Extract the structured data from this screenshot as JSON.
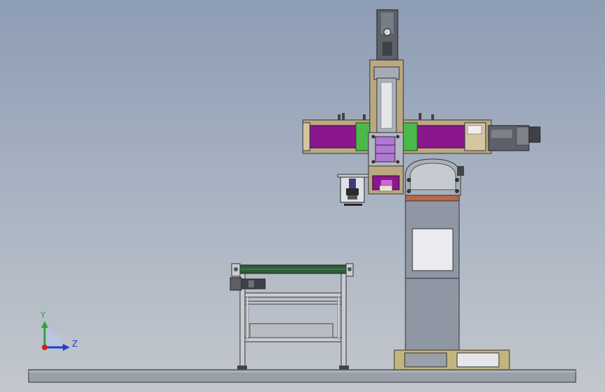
{
  "viewport": {
    "background_top": "#8d9db4",
    "background_bottom": "#c3c7cd"
  },
  "colors": {
    "frame_tan": "#b9a882",
    "purple_panel": "#8a178e",
    "green_bracket": "#4db84a",
    "column_gray": "#8f96a4",
    "conveyor_green": "#2f5d3b",
    "pallet_tan": "#c4b57e",
    "base_gray": "#9aa0a9",
    "rust_band": "#b46a4d"
  },
  "triad": {
    "y_label": "Y",
    "z_label": "Z",
    "y_color": "#2da53b",
    "z_color": "#2440c8",
    "x_color": "#d11f1f"
  }
}
